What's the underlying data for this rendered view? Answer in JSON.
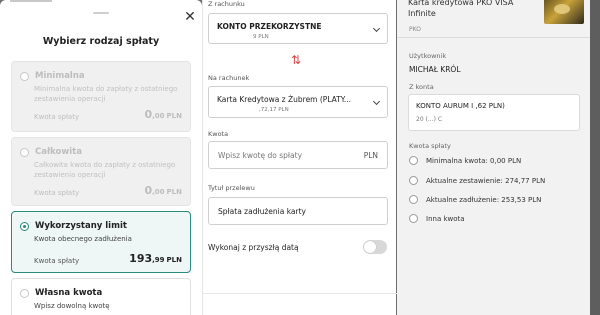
{
  "modal": {
    "title": "Wybierz rodzaj spłaty",
    "close_glyph": "✕",
    "options": [
      {
        "title": "Minimalna",
        "description": "Minimalna kwota do zapłaty z ostatniego zestawienia operacji",
        "amount_label": "Kwota spłaty",
        "amount_int": "0",
        "amount_dec": ",00",
        "currency": "PLN",
        "state": "disabled"
      },
      {
        "title": "Całkowita",
        "description": "Całkowita kwota do zapłaty z ostatniego zestawienia operacji",
        "amount_label": "Kwota spłaty",
        "amount_int": "0",
        "amount_dec": ",00",
        "currency": "PLN",
        "state": "disabled"
      },
      {
        "title": "Wykorzystany limit",
        "description": "Kwota obecnego zadłużenia",
        "amount_label": "Kwota spłaty",
        "amount_int": "193",
        "amount_dec": ",99",
        "currency": "PLN",
        "state": "selected"
      },
      {
        "title": "Własna kwota",
        "description": "Wpisz dowolną kwotę",
        "state": "enabled"
      }
    ]
  },
  "form": {
    "from_label": "Z rachunku",
    "from_account": "KONTO PRZEKORZYSTNE",
    "from_balance": "9 PLN",
    "swap_icon": "⇅",
    "to_label": "Na rachunek",
    "to_account": "Karta Kredytowa z Żubrem (PLATY...",
    "to_balance": ",72,17 PLN",
    "amount_label": "Kwota",
    "amount_placeholder": "Wpisz kwotę do spłaty",
    "amount_currency": "PLN",
    "title_label": "Tytuł przelewu",
    "title_value": "Spłata zadłużenia karty",
    "future_date_label": "Wykonaj z przyszłą datą",
    "future_date_on": false
  },
  "summary": {
    "card_name": "Karta kredytowa PKO VISA Infinite",
    "card_sub": "PKO",
    "user_label": "Użytkownik",
    "user_value": "MICHAŁ KRÓL",
    "from_account_label": "Z konta",
    "from_account_line1": "KONTO AURUM I ,62 PLN)",
    "from_account_line2": "20 (...) C",
    "repay_label": "Kwota spłaty",
    "repay_options": [
      "Minimalna kwota: 0,00 PLN",
      "Aktualne zestawienie: 274,77 PLN",
      "Aktualne zadłużenie: 253,53 PLN",
      "Inna kwota"
    ]
  },
  "colors": {
    "accent": "#2a8a7c",
    "swap_red": "#d64545",
    "overlay": "#6f6f6f"
  }
}
